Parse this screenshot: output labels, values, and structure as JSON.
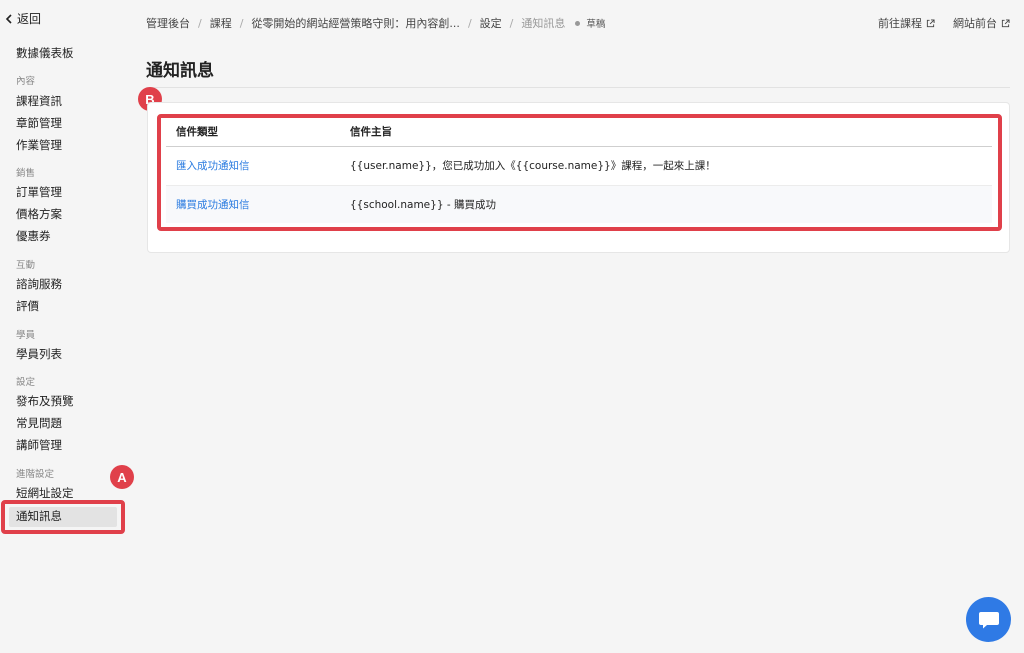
{
  "nav": {
    "back_label": "返回"
  },
  "sidebar": {
    "dashboard": "數據儀表板",
    "sections": [
      {
        "title": "內容",
        "items": [
          "課程資訊",
          "章節管理",
          "作業管理"
        ]
      },
      {
        "title": "銷售",
        "items": [
          "訂單管理",
          "價格方案",
          "優惠券"
        ]
      },
      {
        "title": "互動",
        "items": [
          "諮詢服務",
          "評價"
        ]
      },
      {
        "title": "學員",
        "items": [
          "學員列表"
        ]
      },
      {
        "title": "設定",
        "items": [
          "發布及預覽",
          "常見問題",
          "講師管理"
        ]
      },
      {
        "title": "進階設定",
        "items": [
          "短網址設定",
          "通知訊息"
        ]
      }
    ],
    "active_item": "通知訊息"
  },
  "breadcrumb": {
    "items": [
      "管理後台",
      "課程",
      "從零開始的網站經營策略守則：用內容創...",
      "設定"
    ],
    "current": "通知訊息",
    "status": "草稿"
  },
  "top_links": {
    "go_course": "前往課程",
    "site_front": "網站前台"
  },
  "page": {
    "title": "通知訊息"
  },
  "table": {
    "headers": [
      "信件類型",
      "信件主旨"
    ],
    "rows": [
      {
        "type": "匯入成功通知信",
        "subject": "{{user.name}}，您已成功加入《{{course.name}}》課程，一起來上課！"
      },
      {
        "type": "購買成功通知信",
        "subject": "{{school.name}} - 購買成功"
      }
    ]
  },
  "annotations": {
    "marker_a": "A",
    "marker_b": "B"
  },
  "colors": {
    "accent": "#e0404a",
    "link": "#2a7be0",
    "chat": "#2f7ae5"
  },
  "icons": {
    "back": "chevron-left-icon",
    "external": "external-link-icon",
    "chat": "chat-bubble-icon"
  }
}
